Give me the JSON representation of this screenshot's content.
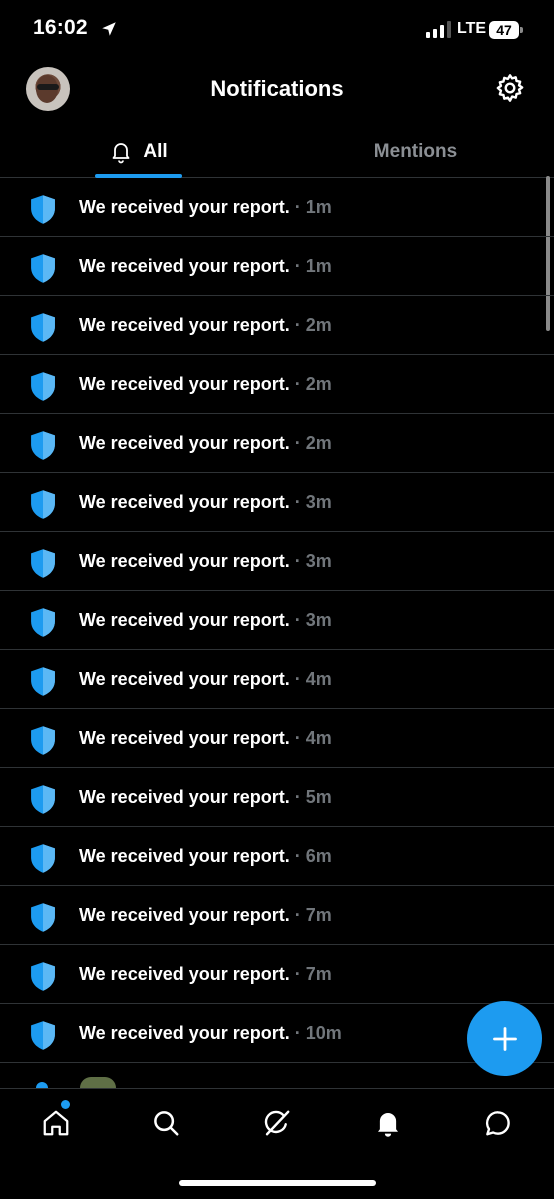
{
  "status_bar": {
    "time": "16:02",
    "network": "LTE",
    "battery": "47"
  },
  "header": {
    "title": "Notifications",
    "avatar_icon": "profile-avatar",
    "settings_icon": "gear-icon"
  },
  "tabs": [
    {
      "label": "All",
      "icon": "bell-icon",
      "selected": true
    },
    {
      "label": "Mentions",
      "selected": false
    }
  ],
  "notifications": [
    {
      "message": "We received your report.",
      "separator": "·",
      "time": "1m"
    },
    {
      "message": "We received your report.",
      "separator": "·",
      "time": "1m"
    },
    {
      "message": "We received your report.",
      "separator": "·",
      "time": "2m"
    },
    {
      "message": "We received your report.",
      "separator": "·",
      "time": "2m"
    },
    {
      "message": "We received your report.",
      "separator": "·",
      "time": "2m"
    },
    {
      "message": "We received your report.",
      "separator": "·",
      "time": "3m"
    },
    {
      "message": "We received your report.",
      "separator": "·",
      "time": "3m"
    },
    {
      "message": "We received your report.",
      "separator": "·",
      "time": "3m"
    },
    {
      "message": "We received your report.",
      "separator": "·",
      "time": "4m"
    },
    {
      "message": "We received your report.",
      "separator": "·",
      "time": "4m"
    },
    {
      "message": "We received your report.",
      "separator": "·",
      "time": "5m"
    },
    {
      "message": "We received your report.",
      "separator": "·",
      "time": "6m"
    },
    {
      "message": "We received your report.",
      "separator": "·",
      "time": "7m"
    },
    {
      "message": "We received your report.",
      "separator": "·",
      "time": "7m"
    },
    {
      "message": "We received your report.",
      "separator": "·",
      "time": "10m"
    }
  ],
  "fab": {
    "icon": "plus-icon"
  },
  "bottom_nav": [
    {
      "name": "home",
      "icon": "home-icon",
      "has_badge_dot": true
    },
    {
      "name": "search",
      "icon": "search-icon"
    },
    {
      "name": "grok",
      "icon": "grok-icon"
    },
    {
      "name": "notifications",
      "icon": "bell-icon",
      "active": true
    },
    {
      "name": "messages",
      "icon": "message-icon"
    }
  ],
  "colors": {
    "background": "#000000",
    "accent": "#1d9bf0",
    "divider": "#2f3336",
    "muted_text": "#71767b",
    "shield": "#1d9bf0"
  }
}
